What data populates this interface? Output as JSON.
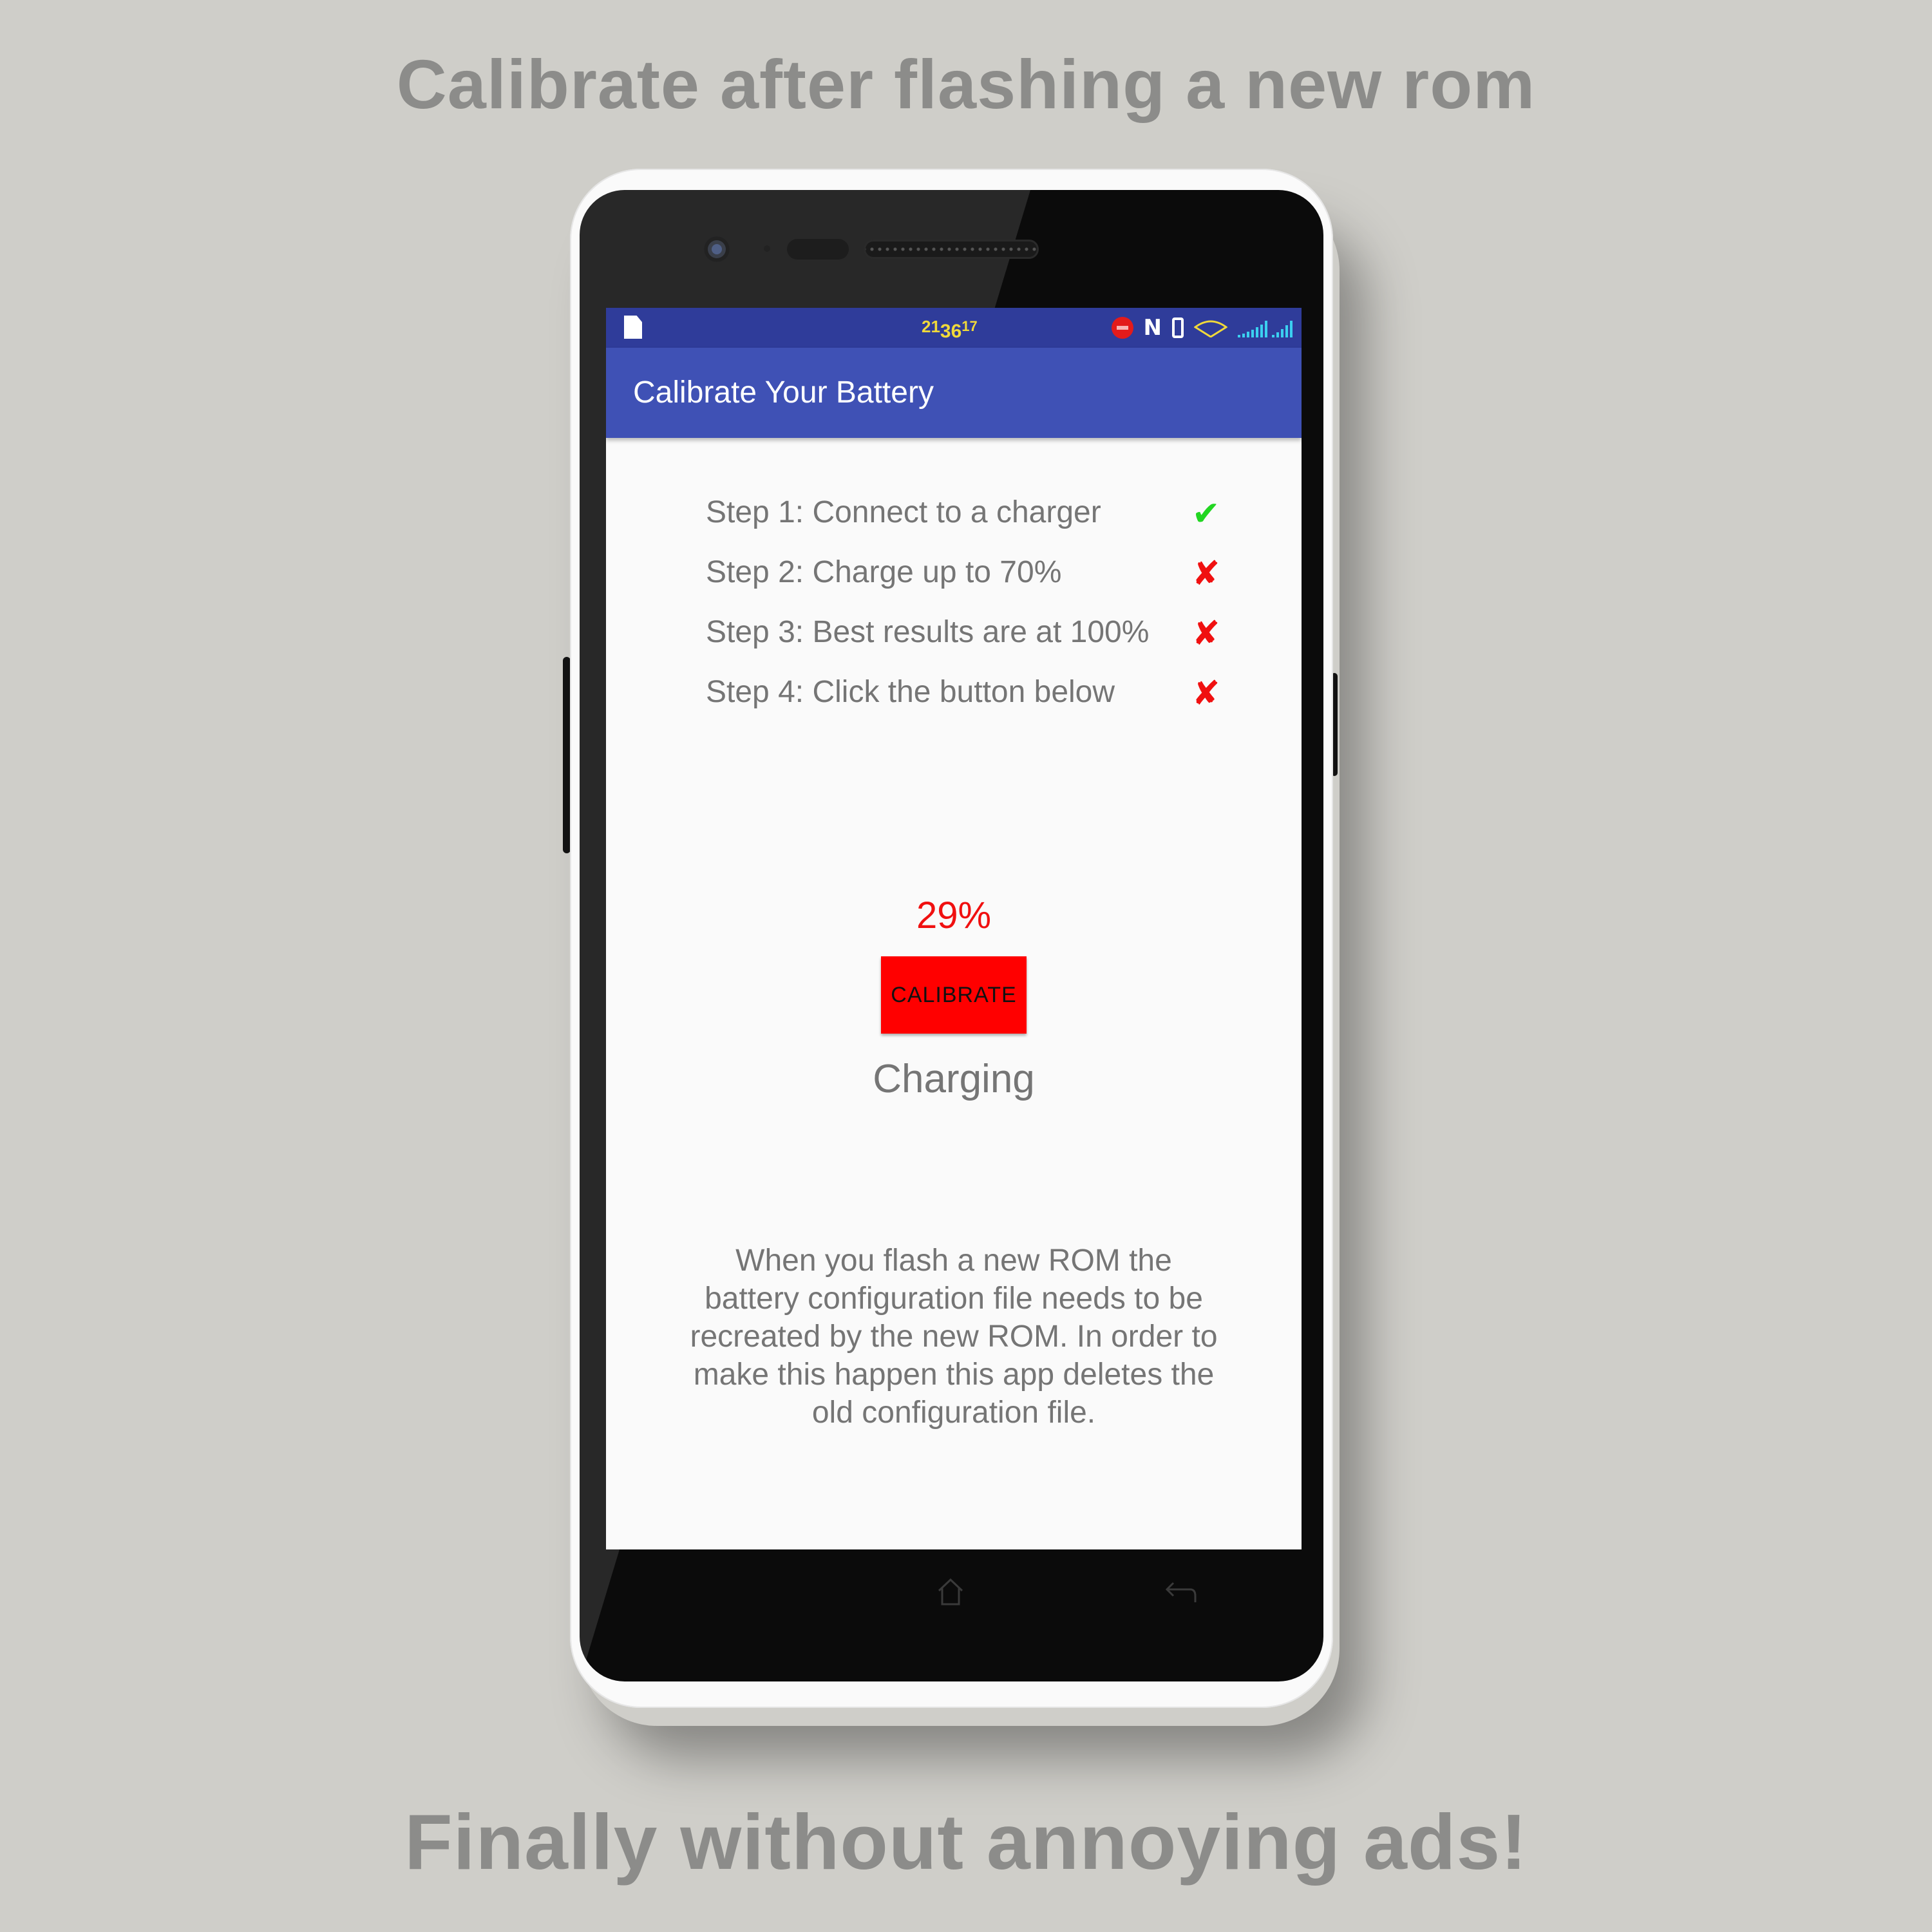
{
  "promo": {
    "headline_top": "Calibrate after flashing a new rom",
    "headline_bottom": "Finally without annoying ads!"
  },
  "status_bar": {
    "clock_hours": "21",
    "clock_minutes": "36",
    "clock_seconds": "17",
    "icons": [
      "file-icon",
      "record-icon",
      "nfc-icon",
      "phone-icon",
      "wifi-icon",
      "signal-icon"
    ],
    "nfc_glyph": "N",
    "clock_color": "#f0d93a"
  },
  "app_bar": {
    "title": "Calibrate Your Battery",
    "color": "#3f51b5"
  },
  "steps": [
    {
      "label": "Step 1: Connect to a charger",
      "mark": "✔",
      "done": true
    },
    {
      "label": "Step 2: Charge up to 70%",
      "mark": "✘",
      "done": false
    },
    {
      "label": "Step 3: Best results are at 100%",
      "mark": "✘",
      "done": false
    },
    {
      "label": "Step 4: Click the button below",
      "mark": "✘",
      "done": false
    }
  ],
  "battery": {
    "percent_label": "29%",
    "status": "Charging",
    "percent_color": "#f01010"
  },
  "calibrate_button": {
    "label": "CALIBRATE",
    "color": "#ff0000"
  },
  "description": "When you flash a new ROM the battery configuration file needs to be recreated by the new ROM. In order to make this happen this app deletes the old configuration file.",
  "nav": {
    "icons": [
      "home-icon",
      "back-icon"
    ]
  }
}
